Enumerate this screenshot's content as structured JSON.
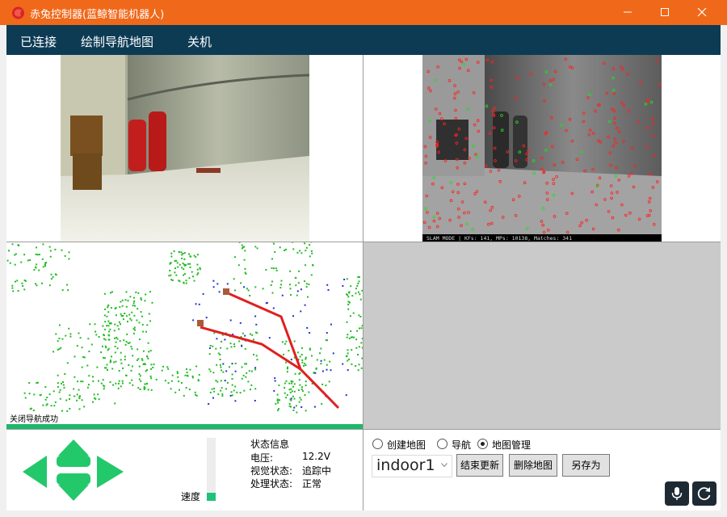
{
  "window": {
    "title": "赤兔控制器(蓝鲸智能机器人)",
    "title_color": "#f0681a",
    "menubar_color": "#0d3b54"
  },
  "menu": {
    "items": [
      "已连接",
      "绘制导航地图",
      "关机"
    ]
  },
  "cameras": {
    "main_view": "camera-feed",
    "slam_view": "slam-feature-view",
    "slam_overlay_text": "SLAM MODE |  KFs: 141, MPs: 10138, Matches: 341"
  },
  "map": {
    "status_text": "关闭导航成功",
    "point_color_obstacle": "#22bb22",
    "point_color_scan": "#2233cc",
    "path_color": "#e02020",
    "status_bar_color": "#1db86a"
  },
  "control": {
    "arrow_color": "#22c86a",
    "speed_label": "速度",
    "speed_level": 0.13,
    "status": {
      "title": "状态信息",
      "rows": [
        {
          "label": "电压:",
          "value": "12.2V"
        },
        {
          "label": "视觉状态:",
          "value": "追踪中"
        },
        {
          "label": "处理状态:",
          "value": "正常"
        }
      ]
    }
  },
  "map_manager": {
    "modes": [
      {
        "label": "创建地图",
        "checked": false
      },
      {
        "label": "导航",
        "checked": false
      },
      {
        "label": "地图管理",
        "checked": true
      }
    ],
    "selected_map": "indoor1",
    "buttons": [
      "结束更新",
      "删除地图",
      "另存为"
    ],
    "icons": [
      "microphone-icon",
      "refresh-icon"
    ]
  }
}
